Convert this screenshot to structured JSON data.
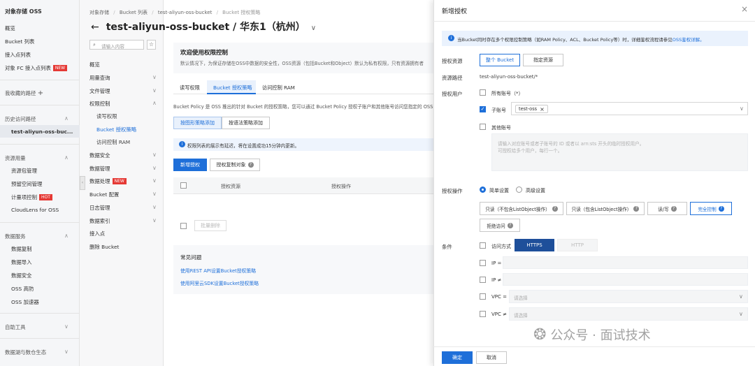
{
  "left_nav": {
    "title": "对象存储 OSS",
    "items": [
      "概览",
      "Bucket 列表",
      "接入点列表",
      "对象 FC 接入点列表"
    ],
    "new_badge": "NEW",
    "my_paths": "我收藏的路径",
    "history": "历史访问路径",
    "history_item": "test-aliyun-oss-buc...",
    "resources": "资源用量",
    "resource_items": [
      "资源包管理",
      "预留空间管理",
      "计量项控制",
      "CloudLens for OSS"
    ],
    "hot_badge": "HOT",
    "data_services": "数据服务",
    "data_items": [
      "数据复制",
      "数据导入",
      "数据安全",
      "OSS 高防",
      "OSS 加速器"
    ],
    "auto_tools": "自助工具",
    "data_lake": "数据湖与数仓生态"
  },
  "second_nav": {
    "search_placeholder": "请输入内容",
    "items": [
      "概览",
      "用量查询",
      "文件管理",
      "权限控制"
    ],
    "perm_subitems": [
      "读写权限",
      "Bucket 授权策略",
      "访问控制 RAM"
    ],
    "items2": [
      "数据安全",
      "数据管理",
      "数据处理",
      "Bucket 配置",
      "日志管理",
      "数据索引",
      "接入点",
      "删除 Bucket"
    ],
    "new_badge": "NEW"
  },
  "main": {
    "breadcrumb": [
      "对象存储",
      "Bucket 列表",
      "test-aliyun-oss-bucket",
      "Bucket 授权策略"
    ],
    "back_arrow": "←",
    "bucket_title": "test-aliyun-oss-bucket / 华东1（杭州）",
    "title_chevron": "∨",
    "welcome_title": "欢迎使用权限控制",
    "welcome_desc": "默认情况下，为保证存储在OSS中数据的安全性，OSS资源（包括Bucket和Object）默认为私有权限，只有资源拥有者",
    "tabs": [
      "读写权限",
      "Bucket 授权策略",
      "访问控制 RAM"
    ],
    "policy_desc": "Bucket Policy 是 OSS 推出的针对 Bucket 的授权策略，您可以通过 Bucket Policy 授权子账户和其他账号访问您指定的 OSS",
    "subtabs": [
      "按图形策略添加",
      "按语法策略添加"
    ],
    "notice": "权限列表的展示有延迟，将在设置成功15分钟内更新。",
    "add_btn": "新增授权",
    "copy_btn": "授权复制对象",
    "col_resource": "授权资源",
    "col_action": "授权操作",
    "batch_delete": "批量删除",
    "faq_title": "常见问题",
    "faq_links": [
      "使用REST API设置Bucket授权策略",
      "使用阿里云SDK设置Bucket授权策略"
    ]
  },
  "drawer": {
    "title": "新增授权",
    "close_icon": "×",
    "info_text": "当Bucket同时存在多个权限控制策略（如RAM Policy、ACL、Bucket Policy等）时，详细鉴权流程请参见",
    "info_link": "OSS鉴权详解。",
    "resource_label": "授权资源",
    "resource_options": [
      "整个 Bucket",
      "指定资源"
    ],
    "path_label": "资源路径",
    "path_value": "test-aliyun-oss-bucket/*",
    "user_label": "授权用户",
    "all_accounts": "所有账号（*）",
    "sub_account": "子账号",
    "sub_account_tag": "test-oss",
    "other_accounts": "其他账号",
    "other_placeholder_1": "请输入对应账号或者子账号的 ID 或者以 arn:sts 开头的临时授权用户。",
    "other_placeholder_2": "可授权给多个用户，每行一个。",
    "action_label": "授权操作",
    "action_modes": [
      "简单设置",
      "高级设置"
    ],
    "action_buttons": [
      "只读（不包含ListObject操作）",
      "只读（包含ListObject操作）",
      "读/写",
      "完全控制",
      "拒绝访问"
    ],
    "condition_label": "条件",
    "cond_access": "访问方式",
    "cond_https": "HTTPS",
    "cond_http": "HTTP",
    "cond_ip_eq": "IP =",
    "cond_ip_ne": "IP ≠",
    "cond_vpc_eq": "VPC =",
    "cond_vpc_ne": "VPC ≠",
    "select_placeholder": "请选择",
    "ok_btn": "确定",
    "cancel_btn": "取消"
  },
  "watermark": "公众号 · 面试技术"
}
